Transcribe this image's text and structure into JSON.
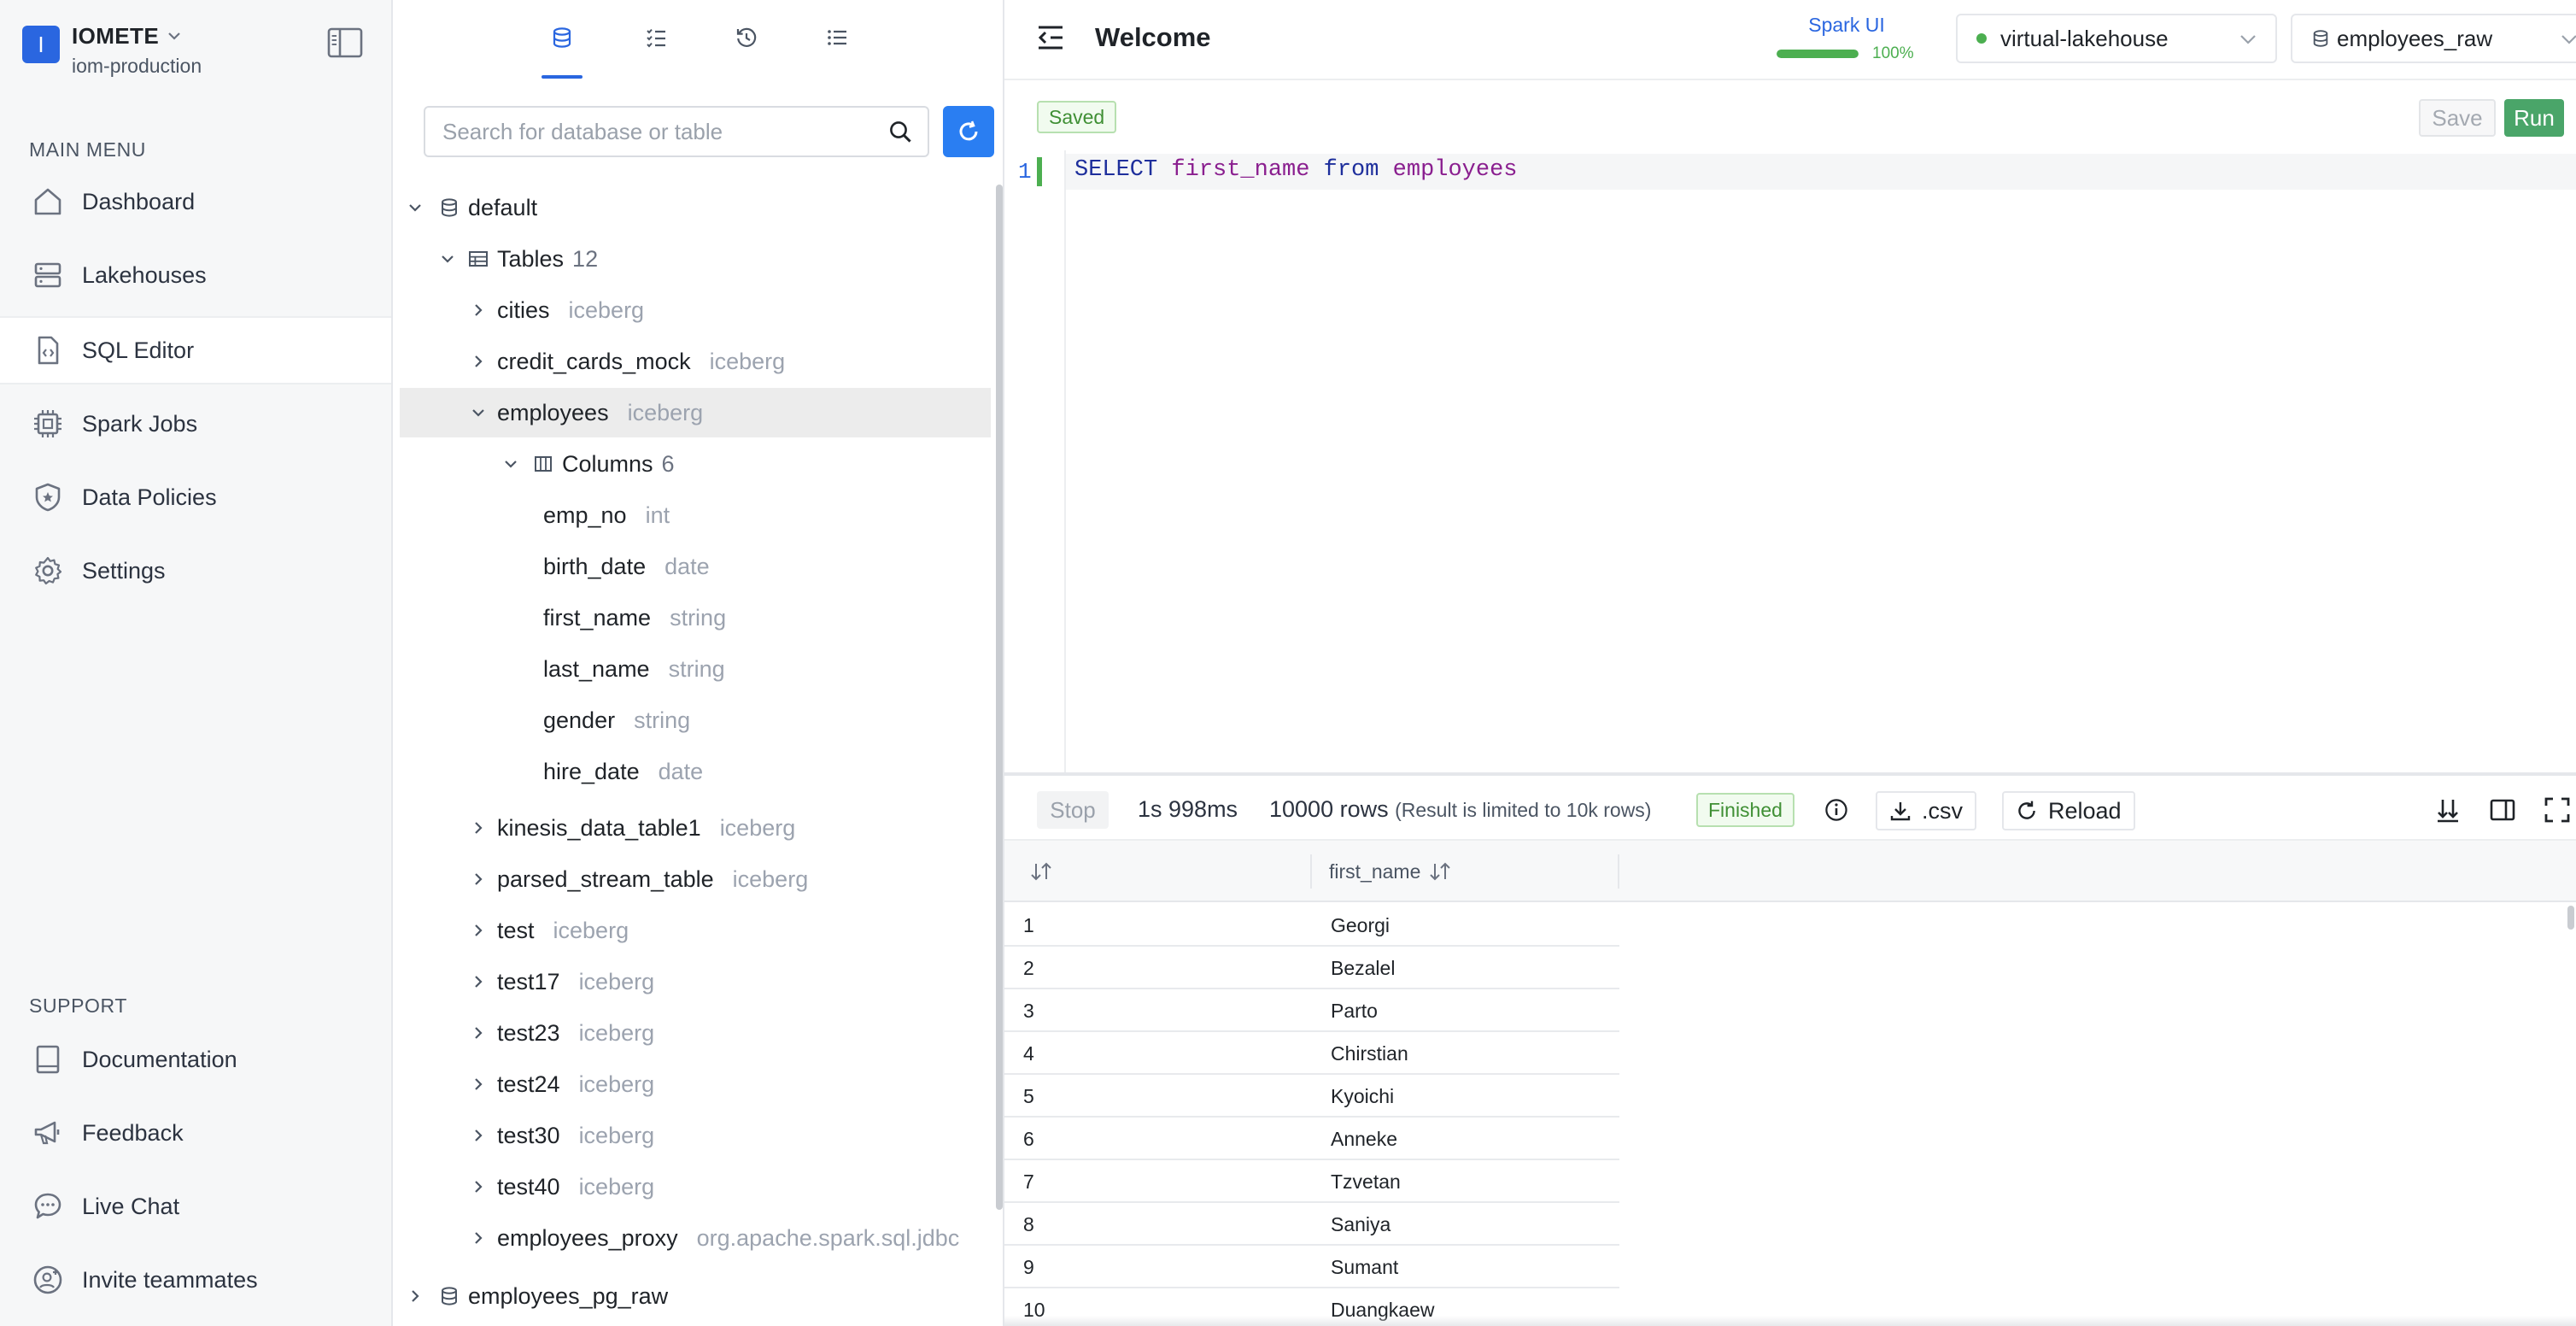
{
  "brand": {
    "initial": "I",
    "name": "IOMETE",
    "org": "iom-production"
  },
  "sidebar": {
    "main_menu_label": "MAIN MENU",
    "main_items": [
      {
        "label": "Dashboard",
        "icon": "home-icon"
      },
      {
        "label": "Lakehouses",
        "icon": "server-icon"
      },
      {
        "label": "SQL Editor",
        "icon": "code-file-icon",
        "active": true
      },
      {
        "label": "Spark Jobs",
        "icon": "cpu-icon"
      },
      {
        "label": "Data Policies",
        "icon": "shield-icon"
      },
      {
        "label": "Settings",
        "icon": "gear-icon"
      }
    ],
    "support_label": "SUPPORT",
    "support_items": [
      {
        "label": "Documentation",
        "icon": "book-icon"
      },
      {
        "label": "Feedback",
        "icon": "megaphone-icon"
      },
      {
        "label": "Live Chat",
        "icon": "chat-icon"
      },
      {
        "label": "Invite teammates",
        "icon": "user-plus-icon"
      }
    ]
  },
  "explorer": {
    "tabs": [
      "database-icon",
      "checklist-icon",
      "history-icon",
      "list-icon"
    ],
    "active_tab": 0,
    "search_placeholder": "Search for database or table",
    "tree": [
      {
        "label": "default"
      },
      {
        "label": "Tables",
        "count": "12"
      },
      {
        "label": "cities",
        "meta": "iceberg"
      },
      {
        "label": "credit_cards_mock",
        "meta": "iceberg"
      },
      {
        "label": "employees",
        "meta": "iceberg"
      },
      {
        "label": "Columns",
        "count": "6"
      },
      {
        "label": "emp_no",
        "meta": "int"
      },
      {
        "label": "birth_date",
        "meta": "date"
      },
      {
        "label": "first_name",
        "meta": "string"
      },
      {
        "label": "last_name",
        "meta": "string"
      },
      {
        "label": "gender",
        "meta": "string"
      },
      {
        "label": "hire_date",
        "meta": "date"
      },
      {
        "label": "kinesis_data_table1",
        "meta": "iceberg"
      },
      {
        "label": "parsed_stream_table",
        "meta": "iceberg"
      },
      {
        "label": "test",
        "meta": "iceberg"
      },
      {
        "label": "test17",
        "meta": "iceberg"
      },
      {
        "label": "test23",
        "meta": "iceberg"
      },
      {
        "label": "test24",
        "meta": "iceberg"
      },
      {
        "label": "test30",
        "meta": "iceberg"
      },
      {
        "label": "test40",
        "meta": "iceberg"
      },
      {
        "label": "employees_proxy",
        "meta": "org.apache.spark.sql.jdbc"
      },
      {
        "label": "employees_pg_raw"
      },
      {
        "label": "employees_raw"
      }
    ]
  },
  "header": {
    "title": "Welcome",
    "spark_ui_label": "Spark UI",
    "spark_progress_pct": 100,
    "spark_progress_label": "100%",
    "lakehouse_select": "virtual-lakehouse",
    "database_select": "employees_raw"
  },
  "editor": {
    "status_badge": "Saved",
    "save_label": "Save",
    "run_label": "Run",
    "line_number": "1",
    "query": {
      "kw1": "SELECT",
      "col": "first_name",
      "kw2": "from",
      "table": "employees"
    }
  },
  "results": {
    "stop_label": "Stop",
    "duration": "1s 998ms",
    "rows_label": "10000 rows",
    "limit_note": "(Result is limited to 10k rows)",
    "status": "Finished",
    "csv_label": ".csv",
    "reload_label": "Reload",
    "column_header": "first_name",
    "rows": [
      {
        "n": "1",
        "first_name": "Georgi"
      },
      {
        "n": "2",
        "first_name": "Bezalel"
      },
      {
        "n": "3",
        "first_name": "Parto"
      },
      {
        "n": "4",
        "first_name": "Chirstian"
      },
      {
        "n": "5",
        "first_name": "Kyoichi"
      },
      {
        "n": "6",
        "first_name": "Anneke"
      },
      {
        "n": "7",
        "first_name": "Tzvetan"
      },
      {
        "n": "8",
        "first_name": "Saniya"
      },
      {
        "n": "9",
        "first_name": "Sumant"
      },
      {
        "n": "10",
        "first_name": "Duangkaew"
      }
    ]
  },
  "colors": {
    "brand_blue": "#2a66e0",
    "refresh_blue": "#2a7ef2",
    "run_green": "#4aa569",
    "success_green": "#4caf50"
  }
}
